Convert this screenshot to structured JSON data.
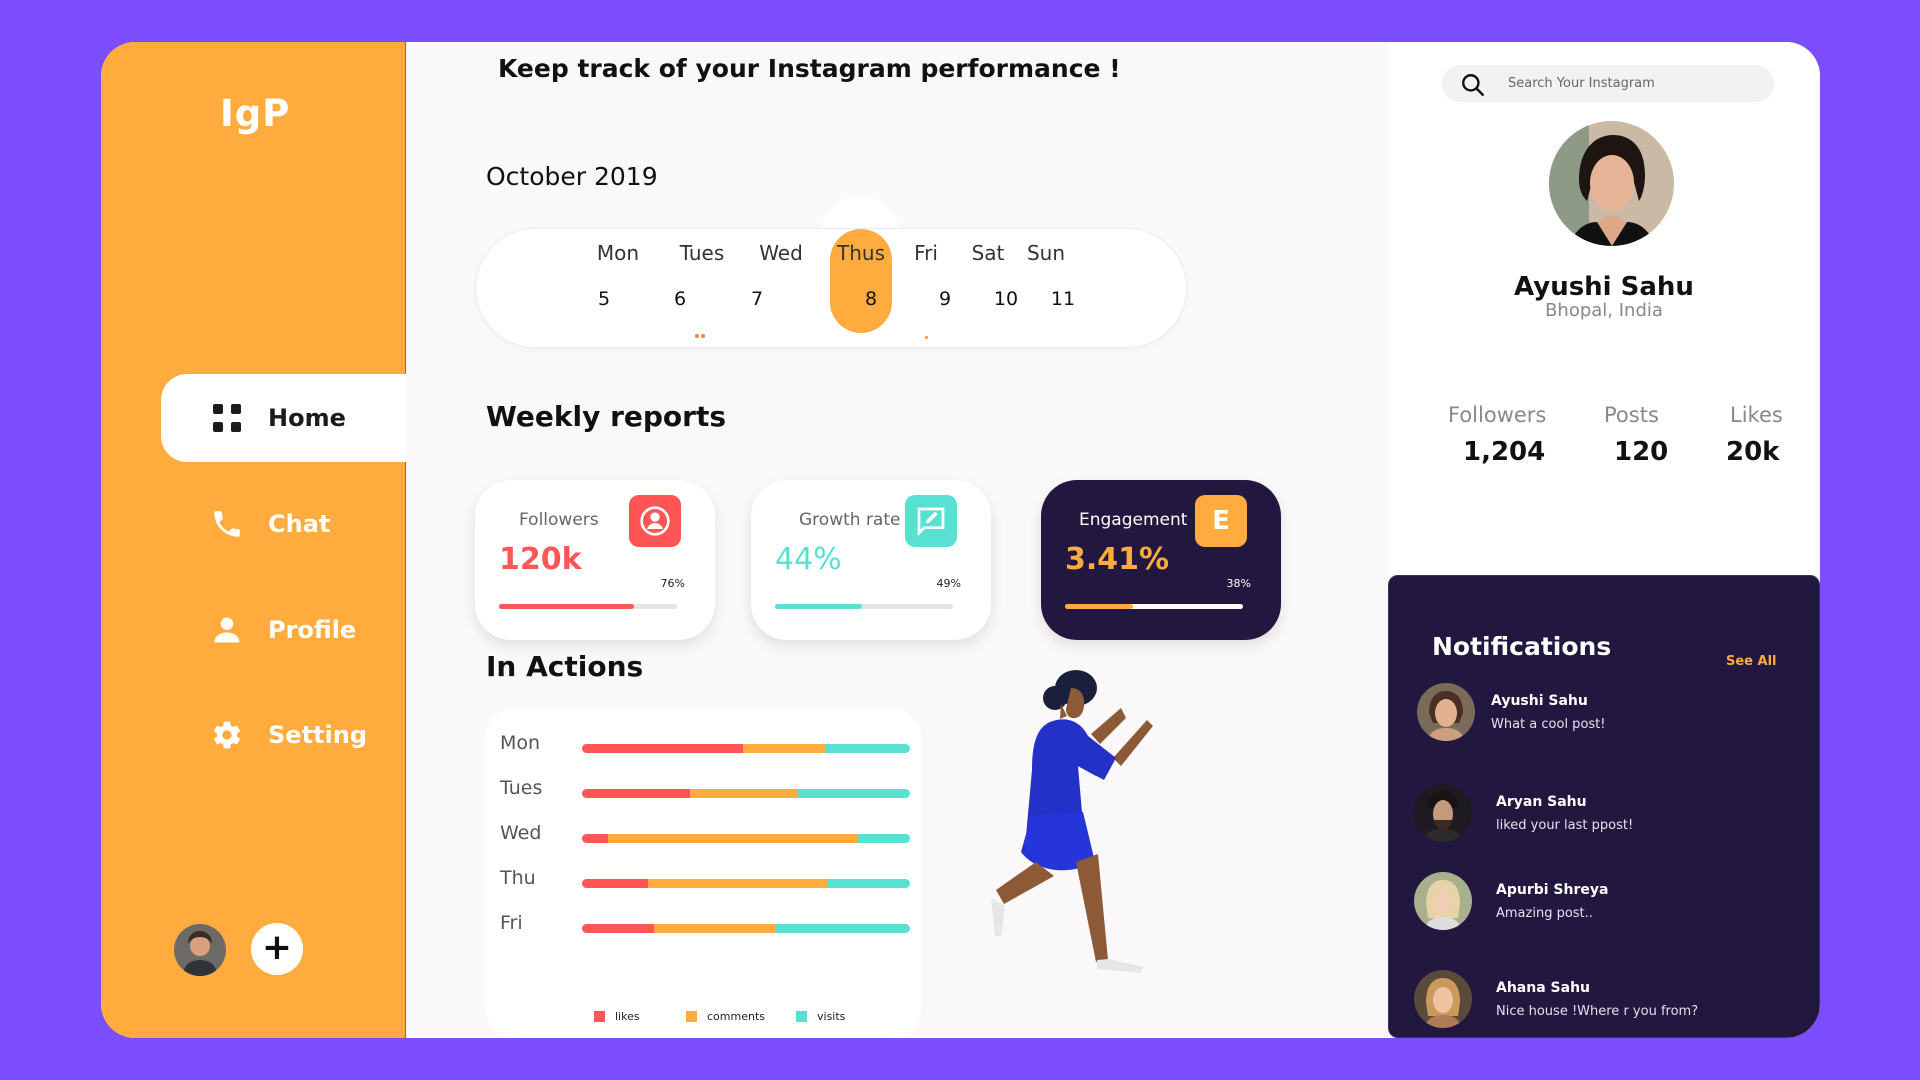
{
  "app": {
    "logo": "IgP"
  },
  "sidebar": {
    "items": [
      {
        "label": "Home",
        "icon": "grid-icon",
        "active": true
      },
      {
        "label": "Chat",
        "icon": "phone-icon",
        "active": false
      },
      {
        "label": "Profile",
        "icon": "user-icon",
        "active": false
      },
      {
        "label": "Setting",
        "icon": "gear-icon",
        "active": false
      }
    ],
    "add_label": "+"
  },
  "main": {
    "headline": "Keep track of your Instagram performance !",
    "month": "October 2019",
    "days": [
      {
        "name": "Mon",
        "num": "5"
      },
      {
        "name": "Tues",
        "num": "6"
      },
      {
        "name": "Wed",
        "num": "7"
      },
      {
        "name": "Thus",
        "num": "8"
      },
      {
        "name": "Fri",
        "num": "9"
      },
      {
        "name": "Sat",
        "num": "10"
      },
      {
        "name": "Sun",
        "num": "11"
      }
    ],
    "selected_day": "Thus",
    "weekly_title": "Weekly reports",
    "cards": [
      {
        "label": "Followers",
        "value": "120k",
        "pct": "76%",
        "progress": 0.76,
        "color": "#ff5555",
        "icon": "user-badge-icon"
      },
      {
        "label": "Growth rate",
        "value": "44%",
        "pct": "49%",
        "progress": 0.49,
        "color": "#58e1d3",
        "icon": "edit-icon"
      },
      {
        "label": "Engagement",
        "value": "3.41%",
        "pct": "38%",
        "progress": 0.38,
        "color": "#ffab3d",
        "icon_letter": "E"
      }
    ],
    "actions_title": "In Actions",
    "actions": [
      {
        "day": "Mon",
        "likes": 0.49,
        "comments": 0.25,
        "visits": 0.26
      },
      {
        "day": "Tues",
        "likes": 0.33,
        "comments": 0.33,
        "visits": 0.34
      },
      {
        "day": "Wed",
        "likes": 0.08,
        "comments": 0.76,
        "visits": 0.16
      },
      {
        "day": "Thu",
        "likes": 0.2,
        "comments": 0.55,
        "visits": 0.25
      },
      {
        "day": "Fri",
        "likes": 0.22,
        "comments": 0.37,
        "visits": 0.41
      }
    ],
    "legend": {
      "likes": "likes",
      "comments": "comments",
      "visits": "visits"
    },
    "colors": {
      "likes": "#ff5555",
      "comments": "#ffab3d",
      "visits": "#58e1d3"
    }
  },
  "right": {
    "search_placeholder": "Search Your Instagram",
    "name": "Ayushi Sahu",
    "location": "Bhopal, India",
    "stats": [
      {
        "label": "Followers",
        "value": "1,204"
      },
      {
        "label": "Posts",
        "value": "120"
      },
      {
        "label": "Likes",
        "value": "20k"
      }
    ],
    "notifications_title": "Notifications",
    "see_all": "See All",
    "notifications": [
      {
        "name": "Ayushi Sahu",
        "msg": "What a cool post!"
      },
      {
        "name": "Aryan Sahu",
        "msg": "liked your last ppost!"
      },
      {
        "name": "Apurbi Shreya",
        "msg": "Amazing post.."
      },
      {
        "name": "Ahana Sahu",
        "msg": "Nice house !Where r you from?"
      }
    ]
  }
}
